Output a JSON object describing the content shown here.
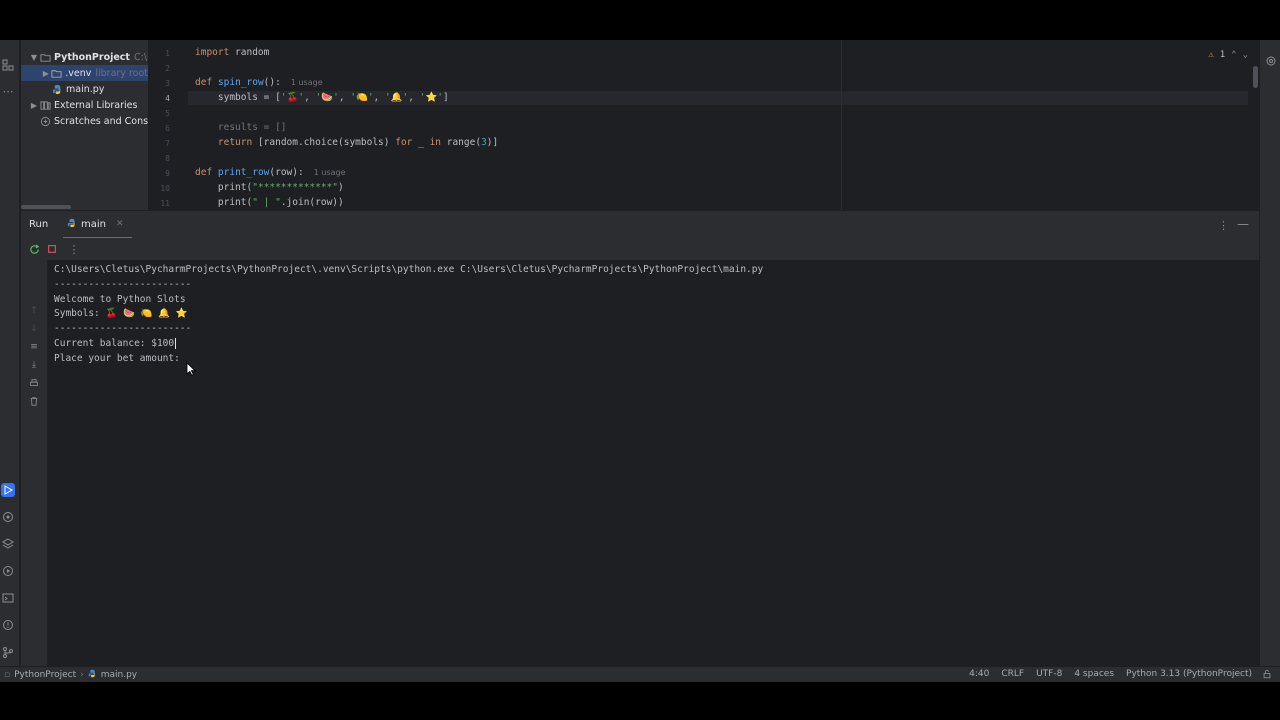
{
  "project_tree": {
    "root_name": "PythonProject",
    "root_path": "C:\\Users",
    "venv_name": ".venv",
    "venv_note": "library root",
    "main_file": "main.py",
    "external_libraries": "External Libraries",
    "scratches": "Scratches and Consoles"
  },
  "editor": {
    "line_numbers": [
      "1",
      "2",
      "3",
      "4",
      "5",
      "6",
      "7",
      "8",
      "9",
      "10",
      "11"
    ],
    "line1_kw": "import",
    "line1_rest": " random",
    "line3_kw": "def",
    "line3_fn": "spin_row",
    "line3_rest": "():",
    "line3_hint": "1 usage",
    "line4_pre": "    symbols = [",
    "line4_sym1": "'🍒'",
    "line4_sym2": "'🍉'",
    "line4_sym3": "'🍋'",
    "line4_sym4": "'🔔'",
    "line4_sym5": "'⭐'",
    "line4_sep": ", ",
    "line4_end": "]",
    "line6": "    results = []",
    "line7_kw": "return",
    "line7_a": " [random.choice(symbols) ",
    "line7_for": "for",
    "line7_b": " _ ",
    "line7_in": "in",
    "line7_c": " range(",
    "line7_num": "3",
    "line7_d": ")]",
    "line9_kw": "def",
    "line9_fn": "print_row",
    "line9_rest": "(row):",
    "line9_hint": "1 usage",
    "line10_a": "    print(",
    "line10_str": "\"*************\"",
    "line10_b": ")",
    "line11_a": "    print(",
    "line11_str": "\" | \"",
    "line11_b": ".join(row))",
    "warning_count": "1"
  },
  "run_panel": {
    "title": "Run",
    "tab": "main",
    "console_lines": [
      "C:\\Users\\Cletus\\PycharmProjects\\PythonProject\\.venv\\Scripts\\python.exe C:\\Users\\Cletus\\PycharmProjects\\PythonProject\\main.py",
      "------------------------",
      "Welcome to Python Slots",
      "Symbols: 🍒 🍉 🍋 🔔 ⭐",
      "------------------------",
      "Current balance: $100",
      "Place your bet amount:"
    ]
  },
  "status_bar": {
    "project": "PythonProject",
    "file": "main.py",
    "position": "4:40",
    "line_ending": "CRLF",
    "encoding": "UTF-8",
    "indent": "4 spaces",
    "interpreter": "Python 3.13 (PythonProject)"
  },
  "colors": {
    "accent": "#3574f0",
    "stop": "#db5c5c"
  }
}
